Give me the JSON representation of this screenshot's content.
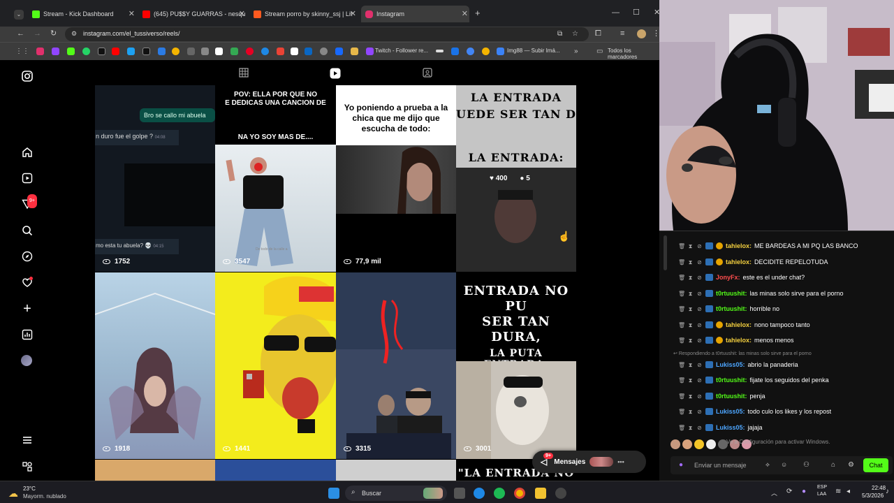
{
  "browser": {
    "tabs": [
      {
        "title": "Stream - Kick Dashboard",
        "color": "#53fc18"
      },
      {
        "title": "(645) PU$$Y GUARRAS - nesqu",
        "color": "#ff0000"
      },
      {
        "title": "Stream porro by skinny_ssj | Lit",
        "color": "#ff5a1f"
      },
      {
        "title": "Instagram",
        "color": "#e1306c"
      }
    ],
    "url": "instagram.com/el_tussiverso/reels/",
    "bookmarks": {
      "twitch": "Twitch - Follower re...",
      "imgbb": "Img88 — Subir Imá...",
      "all": "Todos los marcadores"
    }
  },
  "instagram": {
    "notif_badge": "9+",
    "reels": [
      {
        "views": "1752",
        "bubble": "Bro se callo mi abuela",
        "left1": "n duro fue el golpe ?",
        "t1": "04:08",
        "left2": "mo esta tu abuela?",
        "t2": "04:15"
      },
      {
        "views": "3547",
        "caption": "POV: ELLA POR QUE NO\nE DEDICAS UNA CANCION DE",
        "caption2": "NA YO SOY MAS DE....",
        "watermark": "De todo de la calle a"
      },
      {
        "views": "77,9 mil",
        "caption": "Yo poniendo a prueba a la\nchica que me dijo que\nescucha de todo:"
      },
      {
        "likes": "400",
        "comments": "5",
        "caption": "LA ENTRADA\nUEDE SER TAN D",
        "caption2": "LA ENTRADA:"
      },
      {
        "views": "1918"
      },
      {
        "views": "1441"
      },
      {
        "views": "3315"
      },
      {
        "views": "3001",
        "caption": "ENTRADA NO PU\nSER TAN DURA,",
        "caption2": "LA PUTA ENTRADA:"
      },
      {
        "caption": "\"LA ENTRADA NO PU"
      }
    ],
    "messages": {
      "label": "Mensajes",
      "badge": "9+"
    }
  },
  "chat": {
    "messages": [
      {
        "user": "tahielox",
        "text": "ME BARDEAS A MI PQ LAS BANCO",
        "color": "#f4d03f"
      },
      {
        "user": "tahielox",
        "text": "DECIDITE REPELOTUDA",
        "color": "#f4d03f"
      },
      {
        "user": "JonyFx",
        "text": "este es el under chat?",
        "color": "#ff4d4d"
      },
      {
        "user": "t0rtuushit",
        "text": "las minas solo sirve para el porno",
        "color": "#53fc18"
      },
      {
        "user": "t0rtuushit",
        "text": "horrible no",
        "color": "#53fc18"
      },
      {
        "user": "tahielox",
        "text": "nono tampoco tanto",
        "color": "#f4d03f"
      },
      {
        "user": "tahielox",
        "text": "menos menos",
        "color": "#f4d03f"
      },
      {
        "user": "Lukiss05",
        "text": "abrio la panaderia",
        "color": "#4da6ff"
      },
      {
        "user": "t0rtuushit",
        "text": "fijate los seguidos del penka",
        "color": "#53fc18"
      },
      {
        "user": "t0rtuushit",
        "text": "penja",
        "color": "#53fc18"
      },
      {
        "user": "Lukiss05",
        "text": "todo culo los likes y los repost",
        "color": "#4da6ff"
      },
      {
        "user": "Lukiss05",
        "text": "jajaja",
        "color": "#4da6ff"
      }
    ],
    "reply_note": "Respondiendo a t0rtuushit: las minas solo sirve para el porno",
    "input_placeholder": "Enviar un mensaje",
    "send_label": "Chat",
    "activate": "Ve a Configuración para activar Windows."
  },
  "taskbar": {
    "temp": "23°C",
    "weather": "Mayorm. nublado",
    "search": "Buscar",
    "lang1": "ESP",
    "lang2": "LAA",
    "time": "22:48",
    "date": "5/3/2026"
  }
}
